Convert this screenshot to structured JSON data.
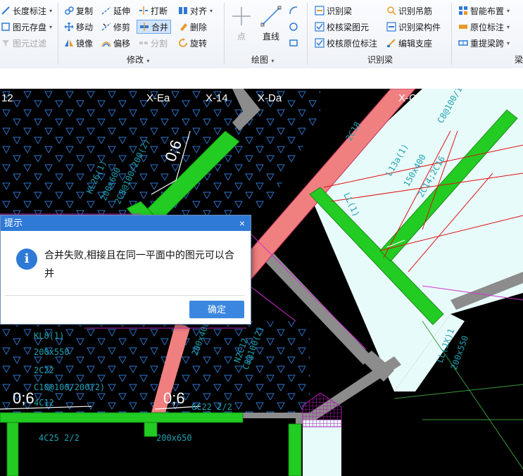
{
  "ribbon": {
    "col1": [
      "长度标注",
      "图元存盘",
      "图元过滤"
    ],
    "modify_col1": [
      "复制",
      "移动",
      "镜像"
    ],
    "modify_col2": [
      "延伸",
      "修剪",
      "偏移"
    ],
    "modify_col3": [
      "打断",
      "合并",
      "分割"
    ],
    "modify_col4": [
      "对齐",
      "删除",
      "旋转"
    ],
    "modify_label": "修改",
    "draw_point": "点",
    "draw_line": "直线",
    "draw_label": "绘图",
    "beam_col1": [
      "识别梁",
      "校核梁图元",
      "校核原位标注"
    ],
    "beam_col2": [
      "识别吊筋",
      "识别梁构件",
      "编辑支座"
    ],
    "beam_label": "识别梁",
    "beam2_col": [
      "智能布置",
      "原位标注",
      "重提梁跨"
    ],
    "beam2_label": "梁"
  },
  "canvas": {
    "axis_labels": [
      "12",
      "X-Ea",
      "X-14",
      "X-Da",
      "X-C"
    ],
    "dims": [
      "0;6",
      "0;6",
      "0;6"
    ],
    "annotations": [
      "KL26(1)",
      "200x600",
      "2C8@100/200(2)",
      "L13a(1)",
      "150x400",
      "2C14;2C16",
      "LL(1)",
      "KL8(1)",
      "200x550",
      "2C22",
      "C10@100/200(2)",
      "4C12",
      "6C22 2/2",
      "4C25 2/2",
      "200x650",
      "LL(JX)1",
      "200x550",
      "N2C12",
      "C8@100(2)",
      "C8@100/1",
      "2C18",
      "200x400"
    ]
  },
  "dialog": {
    "title": "提示",
    "close": "×",
    "message": "合并失败,相接且在同一平面中的图元可以合并",
    "ok": "确定"
  },
  "colors": {
    "beam_green": "#22cc22",
    "beam_pink": "#f08080",
    "slab_cyan": "#e8fbfb",
    "dialog_blue": "#2e7ad6"
  }
}
